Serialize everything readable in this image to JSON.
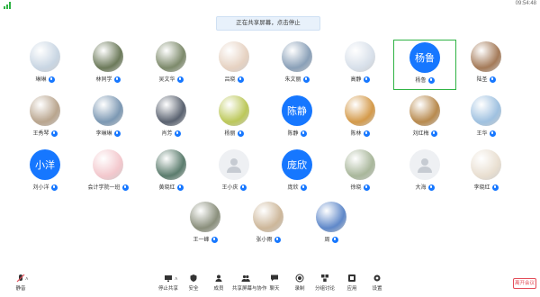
{
  "status": {
    "time": "09:54:48"
  },
  "banner": {
    "text": "正在共享屏幕，点击停止"
  },
  "participants": [
    {
      "name": "琳琳",
      "kind": "photo",
      "color": "#c9d6e3"
    },
    {
      "name": "林同学",
      "kind": "photo",
      "color": "#6c7a5a"
    },
    {
      "name": "吴文华",
      "kind": "photo",
      "color": "#7d8a6b"
    },
    {
      "name": "吕晓",
      "kind": "photo",
      "color": "#e6d2c2"
    },
    {
      "name": "朱文丽",
      "kind": "photo",
      "color": "#8aa0b8"
    },
    {
      "name": "高静",
      "kind": "photo",
      "color": "#d8e0ea"
    },
    {
      "name": "杨鲁",
      "kind": "text",
      "text": "杨鲁"
    },
    {
      "name": "陆圣",
      "kind": "photo",
      "color": "#a47a58"
    },
    {
      "name": "王秀琴",
      "kind": "photo",
      "color": "#b9a58e"
    },
    {
      "name": "李琳琳",
      "kind": "photo",
      "color": "#7c98b3"
    },
    {
      "name": "肖芳",
      "kind": "photo",
      "color": "#5a6270"
    },
    {
      "name": "杨丽",
      "kind": "photo",
      "color": "#bcc85a"
    },
    {
      "name": "陈静",
      "kind": "text",
      "text": "陈静"
    },
    {
      "name": "陈林",
      "kind": "photo",
      "color": "#d49a4a"
    },
    {
      "name": "刘红梅",
      "kind": "photo",
      "color": "#b88a4e"
    },
    {
      "name": "王华",
      "kind": "photo",
      "color": "#9fc1e0"
    },
    {
      "name": "刘小洋",
      "kind": "text",
      "text": "小洋"
    },
    {
      "name": "会计学院一班",
      "kind": "photo",
      "color": "#f3c8cd"
    },
    {
      "name": "黄晓红",
      "kind": "photo",
      "color": "#5b7c6d"
    },
    {
      "name": "王小庆",
      "kind": "placeholder"
    },
    {
      "name": "庞欣",
      "kind": "text",
      "text": "庞欣"
    },
    {
      "name": "徐晓",
      "kind": "photo",
      "color": "#a9b79b"
    },
    {
      "name": "大海",
      "kind": "placeholder"
    },
    {
      "name": "李晓红",
      "kind": "photo",
      "color": "#e9dfd1"
    },
    {
      "name": "王一峰",
      "kind": "photo",
      "color": "#8a8f7c"
    },
    {
      "name": "张小雨",
      "kind": "photo",
      "color": "#cdb79a"
    },
    {
      "name": "周",
      "kind": "photo",
      "color": "#5f88c9"
    }
  ],
  "toolbar": [
    {
      "label": "静音",
      "icon": "mic-muted-icon"
    },
    {
      "label": "停止共享",
      "icon": "share-screen-icon"
    },
    {
      "label": "安全",
      "icon": "shield-icon"
    },
    {
      "label": "成员",
      "icon": "participants-icon"
    },
    {
      "label": "共享屏幕与协作",
      "icon": "users-icon"
    },
    {
      "label": "聊天",
      "icon": "chat-icon"
    },
    {
      "label": "录制",
      "icon": "record-icon"
    },
    {
      "label": "分组讨论",
      "icon": "breakout-icon"
    },
    {
      "label": "应用",
      "icon": "apps-icon"
    },
    {
      "label": "设置",
      "icon": "settings-icon"
    }
  ],
  "leave": {
    "label": "离开会议"
  }
}
